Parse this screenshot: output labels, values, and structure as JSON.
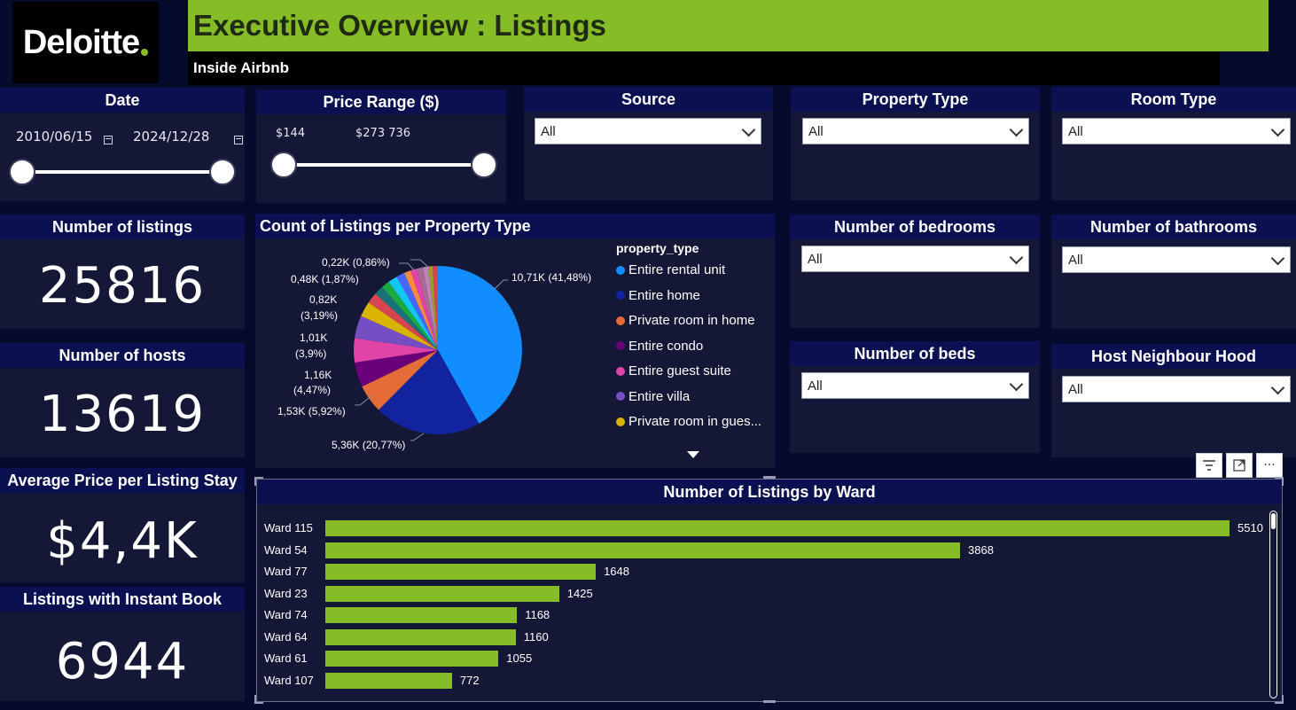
{
  "header": {
    "logo_text": "Deloitte",
    "title": "Executive Overview : Listings",
    "subtitle": "Inside Airbnb"
  },
  "slicers": {
    "date": {
      "title": "Date",
      "start": "2010/06/15",
      "end": "2024/12/28"
    },
    "price": {
      "title": "Price Range ($)",
      "min": "$144",
      "max": "$273 736"
    },
    "source": {
      "title": "Source",
      "value": "All"
    },
    "property_type": {
      "title": "Property Type",
      "value": "All"
    },
    "room_type": {
      "title": "Room Type",
      "value": "All"
    },
    "bedrooms": {
      "title": "Number of bedrooms",
      "value": "All"
    },
    "bathrooms": {
      "title": "Number of bathrooms",
      "value": "All"
    },
    "beds": {
      "title": "Number of beds",
      "value": "All"
    },
    "neighbourhood": {
      "title": "Host Neighbour Hood",
      "value": "All"
    }
  },
  "kpis": {
    "listings": {
      "title": "Number of listings",
      "value": "25816"
    },
    "hosts": {
      "title": "Number of hosts",
      "value": "13619"
    },
    "avg_price": {
      "title": "Average Price per Listing Stay",
      "value": "$4,4K"
    },
    "instant_book": {
      "title": "Listings with Instant Book",
      "value": "6944"
    }
  },
  "pie": {
    "title": "Count of Listings per Property Type",
    "legend_title": "property_type",
    "labels": {
      "l1": "10,71K (41,48%)",
      "l2": "5,36K (20,77%)",
      "l3": "1,53K (5,92%)",
      "l4a": "1,16K",
      "l4b": "(4,47%)",
      "l5a": "1,01K",
      "l5b": "(3,9%)",
      "l6a": "0,82K",
      "l6b": "(3,19%)",
      "l7": "0,48K (1,87%)",
      "l8": "0,22K (0,86%)"
    },
    "legend": [
      {
        "name": "Entire rental unit",
        "color": "#118dff"
      },
      {
        "name": "Entire home",
        "color": "#12239e"
      },
      {
        "name": "Private room in home",
        "color": "#e66c37"
      },
      {
        "name": "Entire condo",
        "color": "#6b007b"
      },
      {
        "name": "Entire guest suite",
        "color": "#e044a7"
      },
      {
        "name": "Entire villa",
        "color": "#744ec2"
      },
      {
        "name": "Private room in gues...",
        "color": "#d9b300"
      }
    ]
  },
  "chart_data": {
    "type": "bar",
    "title": "Number of Listings by Ward",
    "categories": [
      "Ward 115",
      "Ward 54",
      "Ward 77",
      "Ward 23",
      "Ward 74",
      "Ward 64",
      "Ward 61",
      "Ward 107"
    ],
    "values": [
      5510,
      3868,
      1648,
      1425,
      1168,
      1160,
      1055,
      772
    ],
    "bar_color": "#86bc25",
    "orientation": "horizontal"
  },
  "toolbar": {
    "filter_icon": "filter-icon",
    "focus_icon": "focus-mode-icon",
    "more_label": "···"
  }
}
